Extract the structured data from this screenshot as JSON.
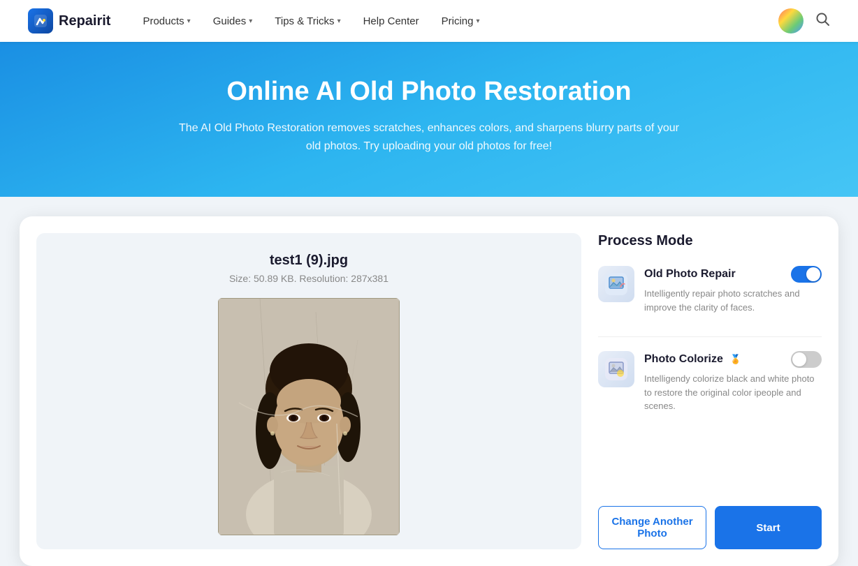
{
  "brand": {
    "logo_text": "Repairit",
    "logo_symbol": "R"
  },
  "navbar": {
    "items": [
      {
        "label": "Products",
        "has_dropdown": true
      },
      {
        "label": "Guides",
        "has_dropdown": true
      },
      {
        "label": "Tips & Tricks",
        "has_dropdown": true
      },
      {
        "label": "Help Center",
        "has_dropdown": false
      },
      {
        "label": "Pricing",
        "has_dropdown": true
      }
    ]
  },
  "hero": {
    "title": "Online AI Old Photo Restoration",
    "subtitle": "The AI Old Photo Restoration removes scratches, enhances colors, and sharpens blurry parts of your old photos. Try uploading your old photos for free!"
  },
  "file_info": {
    "name": "test1 (9).jpg",
    "meta": "Size: 50.89 KB. Resolution: 287x381"
  },
  "process_mode": {
    "title": "Process Mode",
    "modes": [
      {
        "name": "Old Photo Repair",
        "description": "Intelligently repair photo scratches and improve the clarity of faces.",
        "enabled": true,
        "premium": false,
        "icon": "🖼️"
      },
      {
        "name": "Photo Colorize",
        "description": "Intelligendy colorize black and white photo to restore the original color ipeople and scenes.",
        "enabled": false,
        "premium": true,
        "icon": "🎨"
      }
    ]
  },
  "buttons": {
    "change_photo": "Change Another Photo",
    "start": "Start"
  },
  "icons": {
    "search": "🔍",
    "chevron_down": "▾"
  }
}
